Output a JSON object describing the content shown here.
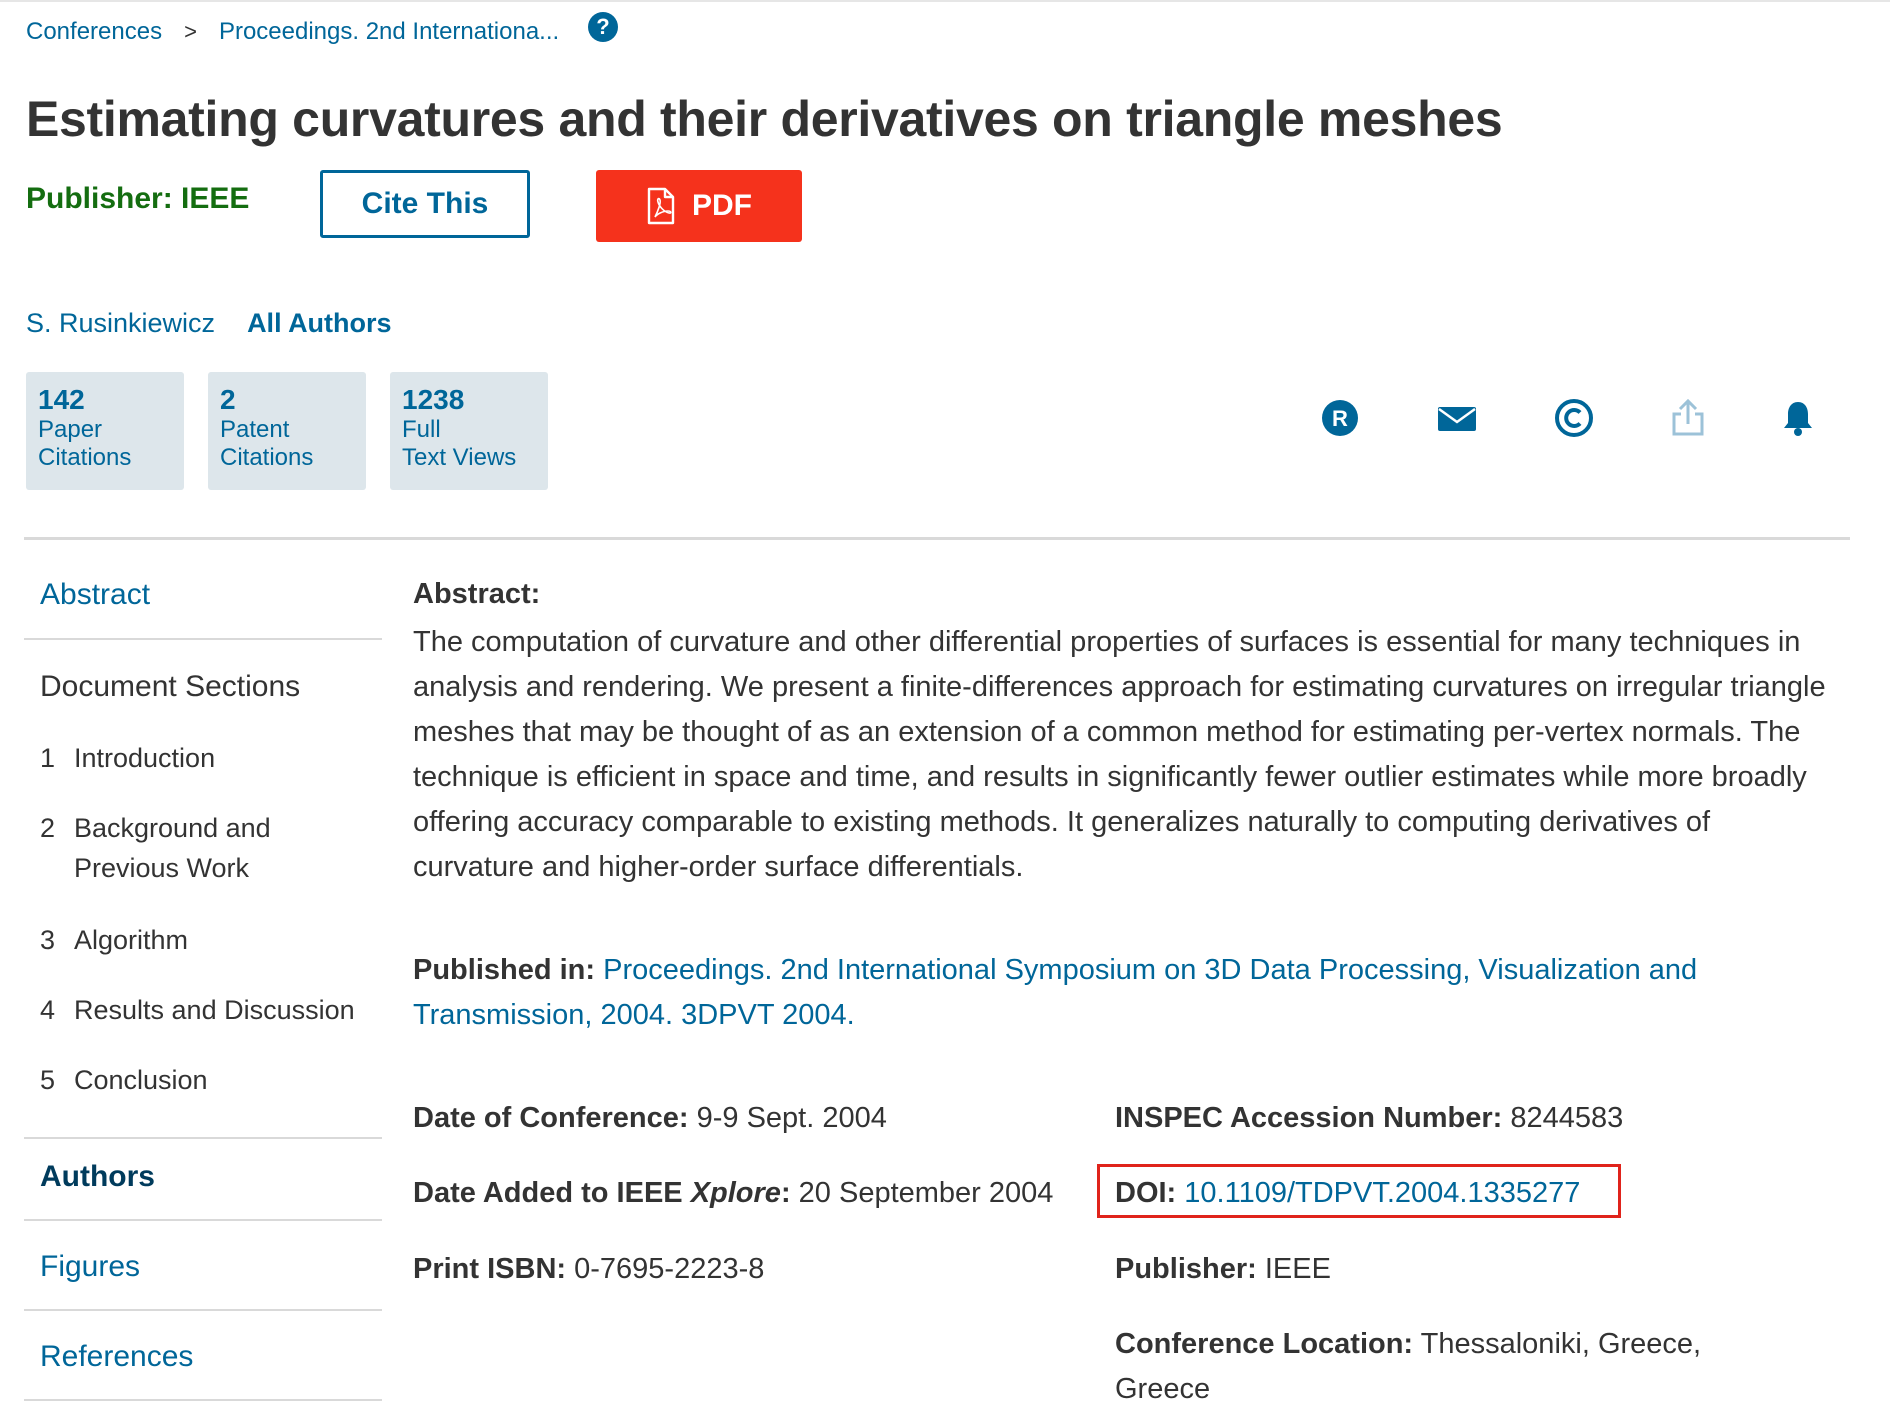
{
  "breadcrumb": {
    "items": [
      "Conferences",
      "Proceedings. 2nd Internationa..."
    ],
    "separator": ">",
    "help_icon": "question-circle-icon"
  },
  "title": "Estimating curvatures and their derivatives on triangle meshes",
  "publisher_line": "Publisher: IEEE",
  "buttons": {
    "cite": "Cite This",
    "pdf": "PDF"
  },
  "authors": {
    "first": "S. Rusinkiewicz",
    "all": "All Authors"
  },
  "metrics": [
    {
      "number": "142",
      "line1": "Paper",
      "line2": "Citations"
    },
    {
      "number": "2",
      "line1": "Patent",
      "line2": "Citations"
    },
    {
      "number": "1238",
      "line1": "Full",
      "line2": "Text Views"
    }
  ],
  "action_icons": [
    "rights-r-icon",
    "email-icon",
    "copyright-icon",
    "share-icon",
    "alert-bell-icon"
  ],
  "sidebar": {
    "abstract": "Abstract",
    "document_sections": "Document Sections",
    "sections": [
      {
        "num": "1",
        "title": "Introduction"
      },
      {
        "num": "2",
        "title": "Background and Previous Work"
      },
      {
        "num": "3",
        "title": "Algorithm"
      },
      {
        "num": "4",
        "title": "Results and Discussion"
      },
      {
        "num": "5",
        "title": "Conclusion"
      }
    ],
    "authors": "Authors",
    "figures": "Figures",
    "references": "References"
  },
  "abstract": {
    "label": "Abstract:",
    "text": "The computation of curvature and other differential properties of surfaces is essential for many techniques in analysis and rendering. We present a finite-differences approach for estimating curvatures on irregular triangle meshes that may be thought of as an extension of a common method for estimating per-vertex normals. The technique is efficient in space and time, and results in significantly fewer outlier estimates while more broadly offering accuracy comparable to existing methods. It generalizes naturally to computing derivatives of curvature and higher-order surface differentials."
  },
  "published_in": {
    "label": "Published in:",
    "value": "Proceedings. 2nd International Symposium on 3D Data Processing, Visualization and Transmission, 2004. 3DPVT 2004."
  },
  "details": {
    "date_of_conference": {
      "label": "Date of Conference:",
      "value": "9-9 Sept. 2004"
    },
    "date_added": {
      "label_prefix": "Date Added to IEEE ",
      "label_italic": "Xplore",
      "label_suffix": ":",
      "value": "20 September 2004"
    },
    "print_isbn": {
      "label": "Print ISBN:",
      "value": "0-7695-2223-8"
    },
    "inspec": {
      "label": "INSPEC Accession Number:",
      "value": "8244583"
    },
    "doi": {
      "label": "DOI:",
      "value": "10.1109/TDPVT.2004.1335277"
    },
    "publisher": {
      "label": "Publisher:",
      "value": "IEEE"
    },
    "conference_location": {
      "label": "Conference Location:",
      "value_line1": "Thessaloniki, Greece,",
      "value_line2": "Greece"
    }
  },
  "colors": {
    "link": "#006699",
    "publisher_green": "#146d10",
    "pdf_red": "#f5321c",
    "metric_bg": "#dde6eb",
    "highlight_box": "#e0231b"
  }
}
